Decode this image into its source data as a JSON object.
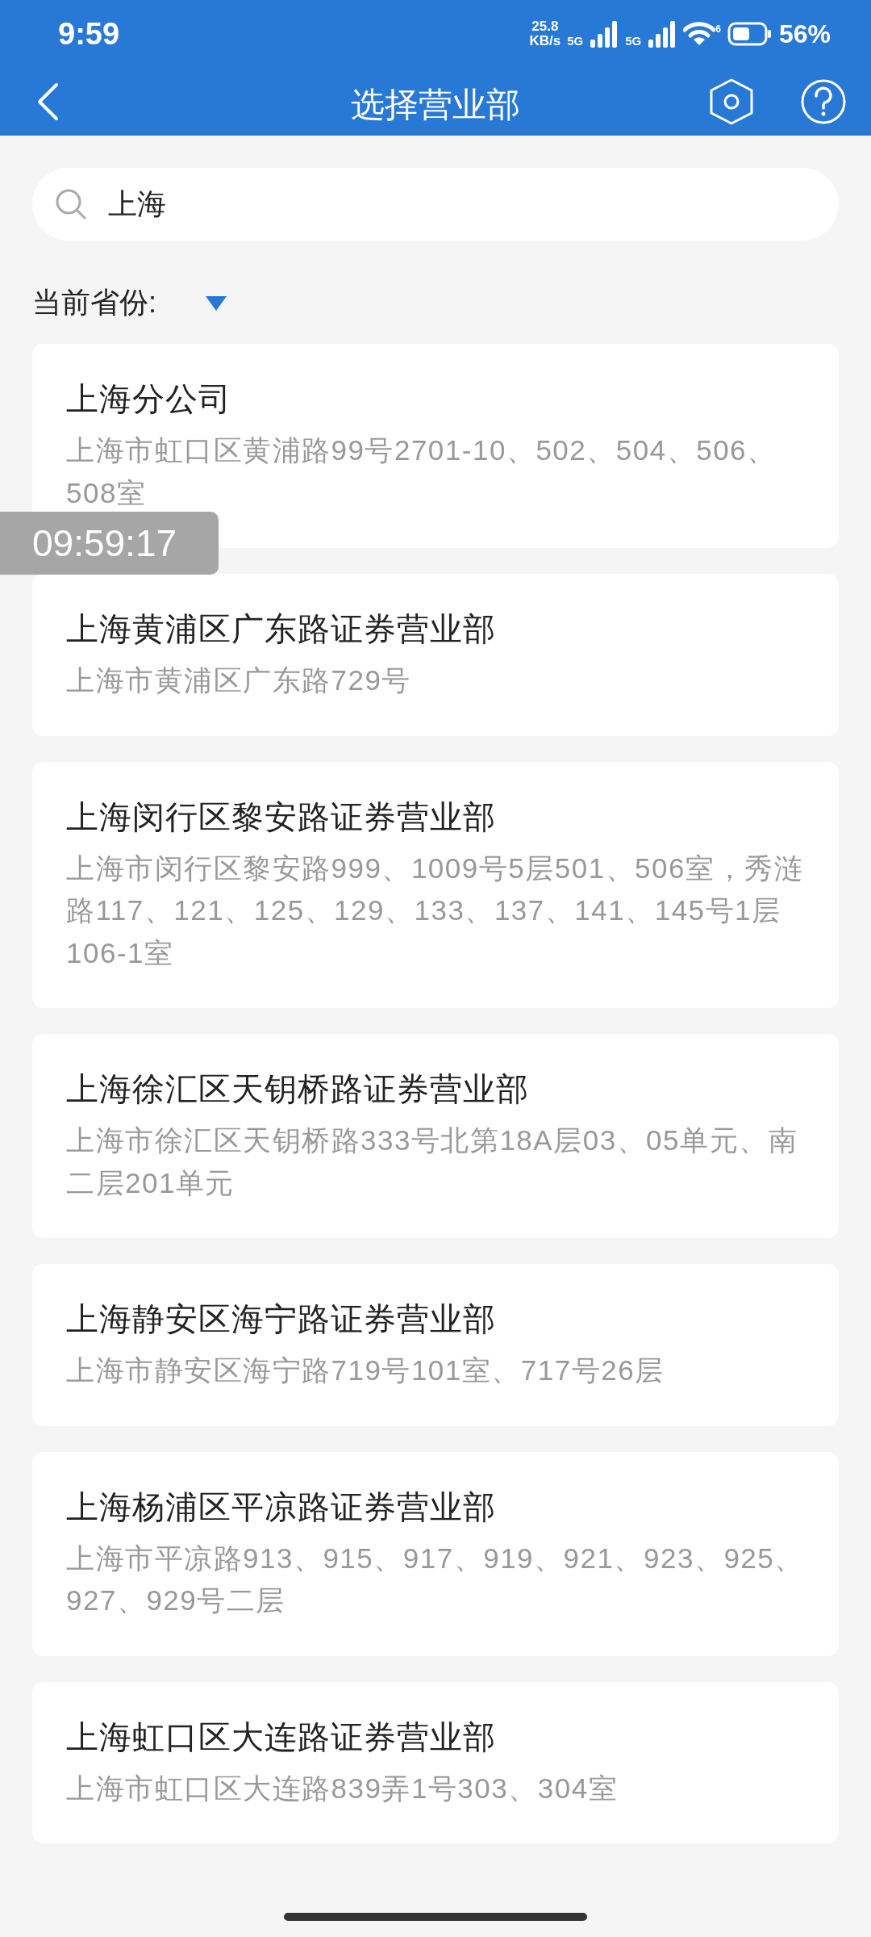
{
  "status_bar": {
    "time": "9:59",
    "speed_value": "25.8",
    "speed_unit": "KB/s",
    "networks": [
      "5G",
      "5G"
    ],
    "wifi_badge": "6",
    "battery": "56%"
  },
  "header": {
    "title": "选择营业部"
  },
  "search": {
    "value": "上海"
  },
  "province": {
    "label": "当前省份:"
  },
  "branches": [
    {
      "name": "上海分公司",
      "address": "上海市虹口区黄浦路99号2701-10、502、504、506、508室"
    },
    {
      "name": "上海黄浦区广东路证券营业部",
      "address": "上海市黄浦区广东路729号"
    },
    {
      "name": "上海闵行区黎安路证券营业部",
      "address": "上海市闵行区黎安路999、1009号5层501、506室，秀涟路117、121、125、129、133、137、141、145号1层106-1室"
    },
    {
      "name": "上海徐汇区天钥桥路证券营业部",
      "address": "上海市徐汇区天钥桥路333号北第18A层03、05单元、南二层201单元"
    },
    {
      "name": "上海静安区海宁路证券营业部",
      "address": "上海市静安区海宁路719号101室、717号26层"
    },
    {
      "name": "上海杨浦区平凉路证券营业部",
      "address": "上海市平凉路913、915、917、919、921、923、925、927、929号二层"
    },
    {
      "name": "上海虹口区大连路证券营业部",
      "address": "上海市虹口区大连路839弄1号303、304室"
    }
  ],
  "timestamp_overlay": "09:59:17"
}
